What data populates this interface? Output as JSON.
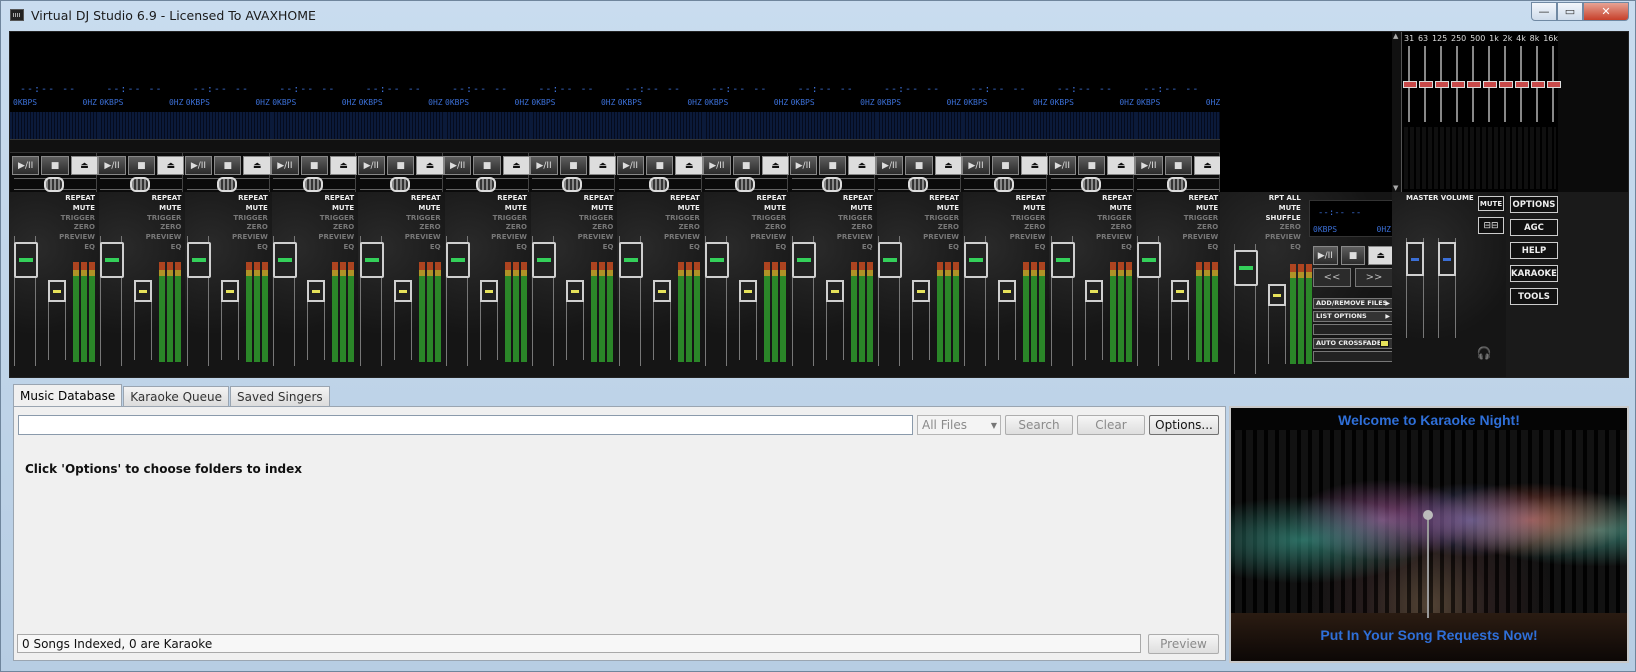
{
  "window": {
    "title": "Virtual DJ Studio 6.9 - Licensed To AVAXHOME",
    "min": "—",
    "max": "▭",
    "close": "✕"
  },
  "deck": {
    "time": "--:-- --",
    "kbps": "0KBPS",
    "hz": "0HZ",
    "play_label": "▶/II",
    "stop_label": "■",
    "eject_label": "⏏",
    "labels": [
      "REPEAT",
      "MUTE",
      "TRIGGER",
      "ZERO",
      "PREVIEW",
      "EQ"
    ]
  },
  "deck_b": {
    "labels": [
      "RPT ALL",
      "MUTE",
      "SHUFFLE",
      "ZERO",
      "PREVIEW",
      "EQ"
    ],
    "prev_label": "<<",
    "next_label": ">>",
    "add_remove": "ADD/REMOVE FILES",
    "list_options": "LIST OPTIONS",
    "auto_crossfade": "AUTO CROSSFADE"
  },
  "eq": {
    "freqs": [
      "31",
      "63",
      "125",
      "250",
      "500",
      "1k",
      "2k",
      "4k",
      "8k",
      "16k"
    ]
  },
  "master": {
    "label": "MASTER VOLUME",
    "mute": "MUTE",
    "link": "⊟⊟",
    "headphones": "🎧"
  },
  "side_buttons": [
    "OPTIONS",
    "AGC",
    "HELP",
    "KARAOKE",
    "TOOLS"
  ],
  "tabs": [
    "Music Database",
    "Karaoke Queue",
    "Saved Singers"
  ],
  "database": {
    "search_value": "",
    "filter": "All Files",
    "search_btn": "Search",
    "clear_btn": "Clear",
    "options_btn": "Options...",
    "hint": "Click 'Options' to choose folders to index",
    "status": "0 Songs Indexed, 0 are Karaoke",
    "preview_btn": "Preview"
  },
  "karaoke": {
    "welcome": "Welcome to Karaoke Night!",
    "requests": "Put In Your Song Requests Now!"
  }
}
